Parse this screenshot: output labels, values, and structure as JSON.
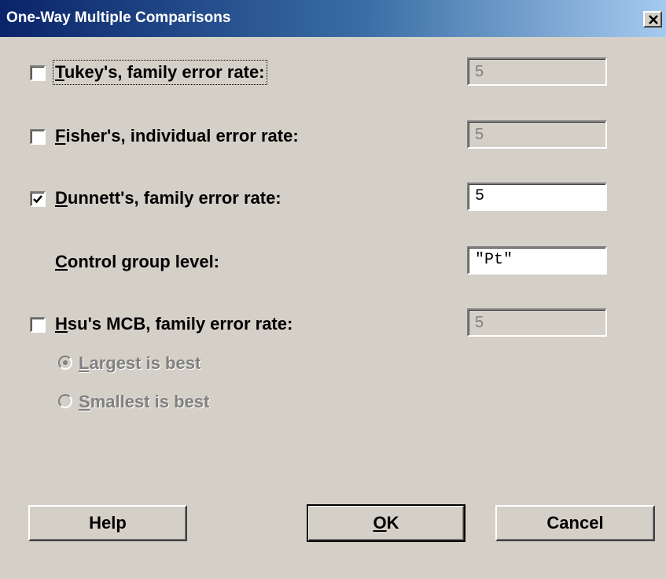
{
  "window": {
    "title": "One-Way Multiple Comparisons",
    "close_glyph": "✕"
  },
  "options": {
    "tukey": {
      "label_key": "T",
      "label_rest": "ukey's, family error rate:",
      "checked": false,
      "value": "5",
      "enabled": false
    },
    "fisher": {
      "label_key": "F",
      "label_rest": "isher's, individual error rate:",
      "checked": false,
      "value": "5",
      "enabled": false
    },
    "dunnett": {
      "label_key": "D",
      "label_rest": "unnett's, family error rate:",
      "checked": true,
      "value": "5",
      "enabled": true
    },
    "control_group": {
      "label_key": "C",
      "label_rest": "ontrol group level:",
      "value": "\"Pt\""
    },
    "hsu": {
      "label_key": "H",
      "label_rest": "su's MCB, family error rate:",
      "checked": false,
      "value": "5",
      "enabled": false
    },
    "hsu_choice": {
      "largest_key": "L",
      "largest_rest": "argest is best",
      "smallest_key": "S",
      "smallest_rest": "mallest is best",
      "selected": "largest"
    }
  },
  "buttons": {
    "help": "Help",
    "ok_key": "O",
    "ok_rest": "K",
    "cancel": "Cancel"
  }
}
